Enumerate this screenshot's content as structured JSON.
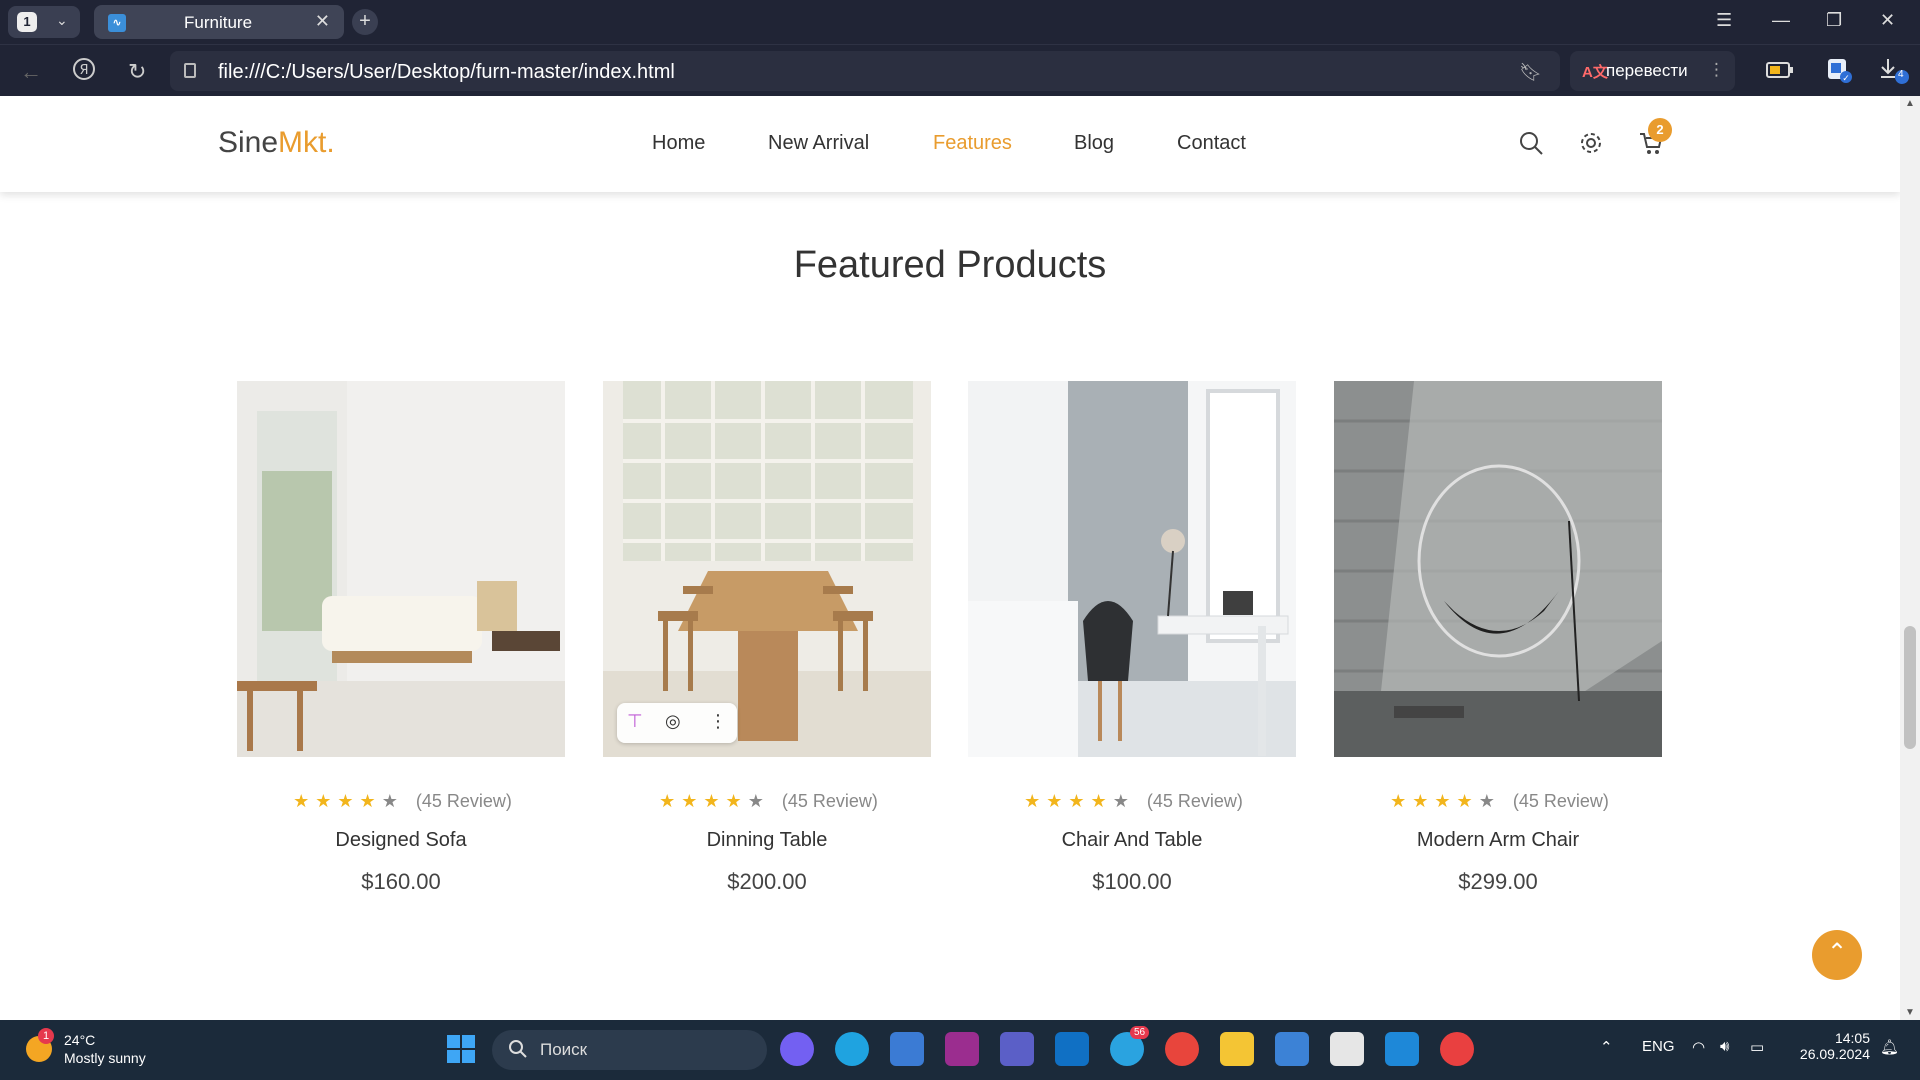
{
  "browser": {
    "tab_count": "1",
    "tab_title": "Furniture",
    "url": "file:///C:/Users/User/Desktop/furn-master/index.html",
    "translate_label": "перевести"
  },
  "site": {
    "logo_main": "Sine",
    "logo_accent": "Mkt",
    "logo_dot": ".",
    "nav": [
      "Home",
      "New Arrival",
      "Features",
      "Blog",
      "Contact"
    ],
    "active_nav": "Features",
    "cart_count": "2",
    "accent_color": "#e99c2e"
  },
  "section_title": "Featured Products",
  "products": [
    {
      "name": "Designed Sofa",
      "price": "$160.00",
      "reviews": "(45 Review)",
      "rating": 4
    },
    {
      "name": "Dinning Table",
      "price": "$200.00",
      "reviews": "(45 Review)",
      "rating": 4
    },
    {
      "name": "Chair And Table",
      "price": "$100.00",
      "reviews": "(45 Review)",
      "rating": 4
    },
    {
      "name": "Modern Arm Chair",
      "price": "$299.00",
      "reviews": "(45 Review)",
      "rating": 4
    }
  ],
  "taskbar": {
    "weather_temp": "24°C",
    "weather_desc": "Mostly sunny",
    "weather_badge": "1",
    "search_placeholder": "Поиск",
    "telegram_badge": "56",
    "lang": "ENG",
    "time": "14:05",
    "date": "26.09.2024"
  },
  "downloads_badge": "4"
}
